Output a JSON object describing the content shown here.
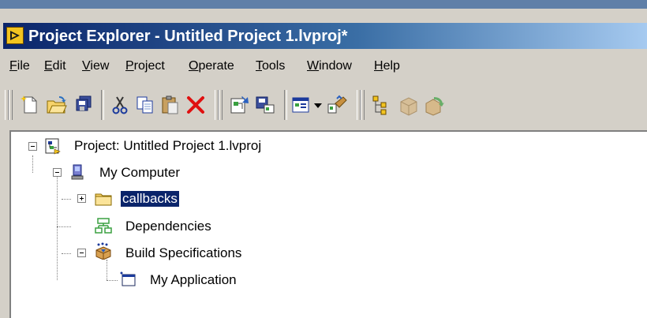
{
  "window": {
    "title": "Project Explorer - Untitled Project 1.lvproj*"
  },
  "menu": [
    "File",
    "Edit",
    "View",
    "Project",
    "Operate",
    "Tools",
    "Window",
    "Help"
  ],
  "toolbar": {
    "buttons": [
      "new-icon",
      "open-icon",
      "save-all-icon",
      "cut-icon",
      "copy-icon",
      "paste-icon",
      "delete-icon",
      "project-settings-icon",
      "save-project-icon",
      "view-icon",
      "dropdown-arrow-icon",
      "build-icon",
      "hierarchy-icon",
      "package-icon",
      "deploy-icon"
    ]
  },
  "tree": {
    "project": "Project: Untitled Project 1.lvproj",
    "computer": "My Computer",
    "callbacks": "callbacks",
    "dependencies": "Dependencies",
    "build_specs": "Build Specifications",
    "application": "My Application"
  },
  "colors": {
    "selection": "#0a246a",
    "title_start": "#0a246a",
    "title_end": "#a6caf0",
    "face": "#d4d0c8"
  }
}
